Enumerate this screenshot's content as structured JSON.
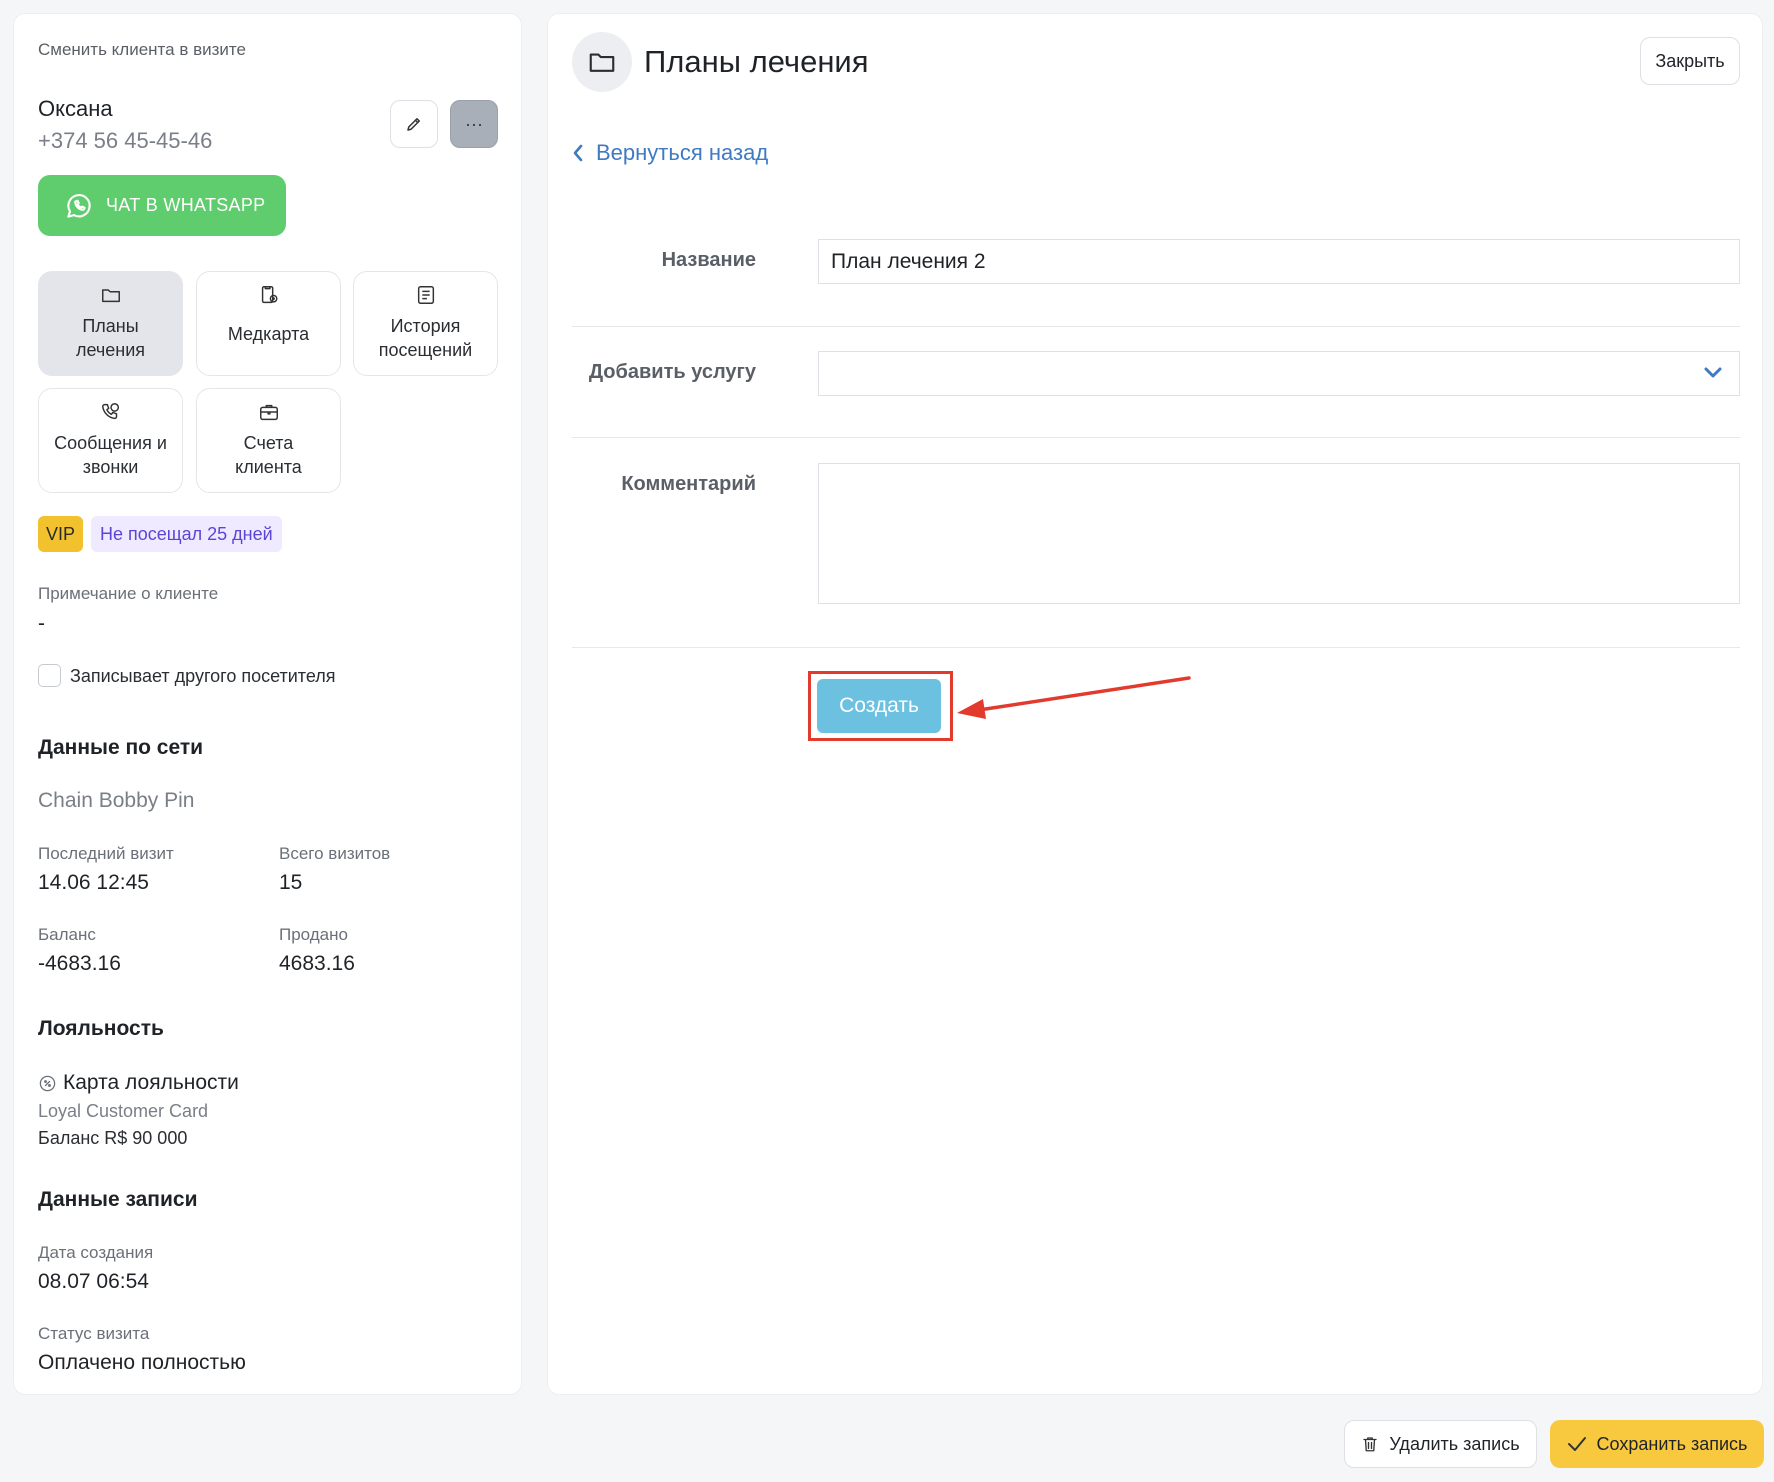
{
  "client": {
    "change_label": "Сменить клиента в визите",
    "name": "Оксана",
    "phone": "+374 56 45-45-46",
    "more_label": "···",
    "whatsapp_label": "ЧАТ В WHATSAPP"
  },
  "tiles": [
    {
      "line1": "Планы",
      "line2": "лечения"
    },
    {
      "line1": "Медкарта"
    },
    {
      "line1": "История",
      "line2": "посещений"
    },
    {
      "line1": "Сообщения и",
      "line2": "звонки"
    },
    {
      "line1": "Счета",
      "line2": "клиента"
    }
  ],
  "tags": {
    "vip": "VIP",
    "not_visited": "Не посещал 25 дней"
  },
  "note": {
    "label": "Примечание о клиенте",
    "value": "-"
  },
  "checkbox_label": "Записывает другого посетителя",
  "network": {
    "title": "Данные по сети",
    "chain_name": "Chain Bobby Pin",
    "last_visit_label": "Последний визит",
    "last_visit_value": "14.06 12:45",
    "total_visits_label": "Всего визитов",
    "total_visits_value": "15",
    "balance_label": "Баланс",
    "balance_value": "-4683.16",
    "sold_label": "Продано",
    "sold_value": "4683.16"
  },
  "loyalty": {
    "title": "Лояльность",
    "card_title": "Карта лояльности",
    "card_name": "Loyal Customer Card",
    "card_balance": "Баланс R$ 90 000"
  },
  "record": {
    "title": "Данные записи",
    "created_label": "Дата создания",
    "created_value": "08.07 06:54",
    "status_label": "Статус визита",
    "status_value": "Оплачено полностью"
  },
  "plan_page": {
    "title": "Планы лечения",
    "close_label": "Закрыть",
    "back_label": "Вернуться назад",
    "name_label": "Название",
    "name_value": "План лечения 2",
    "service_label": "Добавить услугу",
    "service_value": "",
    "comment_label": "Комментарий",
    "comment_value": "",
    "create_label": "Создать"
  },
  "footer": {
    "delete_label": "Удалить запись",
    "save_label": "Сохранить запись"
  },
  "colors": {
    "whatsapp": "#5fcd6e",
    "vip": "#f2c12e",
    "link": "#3f7ac2",
    "create": "#6cc1e1",
    "highlight": "#e23b2e",
    "save": "#f8c93f"
  }
}
